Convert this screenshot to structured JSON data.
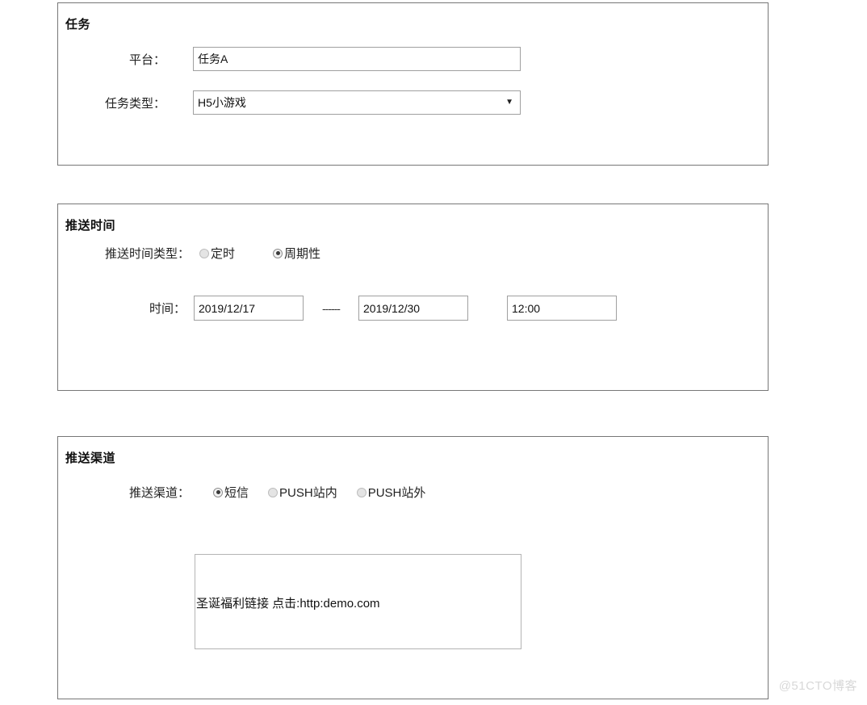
{
  "panels": {
    "task": {
      "title": "任务",
      "platform": {
        "label": "平台：",
        "value": "任务A",
        "placeholder": ""
      },
      "task_type": {
        "label": "任务类型：",
        "value": "H5小游戏",
        "placeholder": "",
        "caret": "▼",
        "options": [
          "H5小游戏"
        ]
      }
    },
    "push_time": {
      "title": "推送时间",
      "type_row": {
        "label": "推送时间类型：",
        "options": [
          {
            "label": "定时",
            "checked": false
          },
          {
            "label": "周期性",
            "checked": true
          }
        ]
      },
      "time_row": {
        "label": "时间：",
        "start_date": "2019/12/17",
        "separator": "------",
        "end_date": "2019/12/30",
        "time_of_day": "12:00"
      }
    },
    "push_channel": {
      "title": "推送渠道",
      "channel_row": {
        "label": "推送渠道：",
        "options": [
          {
            "label": "短信",
            "checked": true
          },
          {
            "label": "PUSH站内",
            "checked": false
          },
          {
            "label": "PUSH站外",
            "checked": false
          }
        ]
      },
      "message": {
        "value": "圣诞福利链接 点击:http:demo.com",
        "placeholder": ""
      }
    }
  },
  "watermark": "@51CTO博客",
  "colors": {
    "panel_border": "#777777",
    "input_border": "#a0a0a0",
    "text": "#1a1a1a",
    "watermark": "#d8d8d8"
  }
}
